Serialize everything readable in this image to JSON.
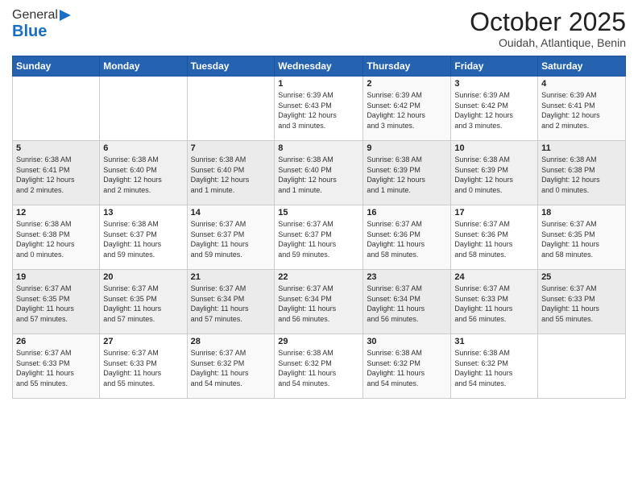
{
  "logo": {
    "general": "General",
    "blue": "Blue"
  },
  "header": {
    "month": "October 2025",
    "location": "Ouidah, Atlantique, Benin"
  },
  "days_of_week": [
    "Sunday",
    "Monday",
    "Tuesday",
    "Wednesday",
    "Thursday",
    "Friday",
    "Saturday"
  ],
  "weeks": [
    [
      {
        "day": "",
        "info": ""
      },
      {
        "day": "",
        "info": ""
      },
      {
        "day": "",
        "info": ""
      },
      {
        "day": "1",
        "info": "Sunrise: 6:39 AM\nSunset: 6:43 PM\nDaylight: 12 hours\nand 3 minutes."
      },
      {
        "day": "2",
        "info": "Sunrise: 6:39 AM\nSunset: 6:42 PM\nDaylight: 12 hours\nand 3 minutes."
      },
      {
        "day": "3",
        "info": "Sunrise: 6:39 AM\nSunset: 6:42 PM\nDaylight: 12 hours\nand 3 minutes."
      },
      {
        "day": "4",
        "info": "Sunrise: 6:39 AM\nSunset: 6:41 PM\nDaylight: 12 hours\nand 2 minutes."
      }
    ],
    [
      {
        "day": "5",
        "info": "Sunrise: 6:38 AM\nSunset: 6:41 PM\nDaylight: 12 hours\nand 2 minutes."
      },
      {
        "day": "6",
        "info": "Sunrise: 6:38 AM\nSunset: 6:40 PM\nDaylight: 12 hours\nand 2 minutes."
      },
      {
        "day": "7",
        "info": "Sunrise: 6:38 AM\nSunset: 6:40 PM\nDaylight: 12 hours\nand 1 minute."
      },
      {
        "day": "8",
        "info": "Sunrise: 6:38 AM\nSunset: 6:40 PM\nDaylight: 12 hours\nand 1 minute."
      },
      {
        "day": "9",
        "info": "Sunrise: 6:38 AM\nSunset: 6:39 PM\nDaylight: 12 hours\nand 1 minute."
      },
      {
        "day": "10",
        "info": "Sunrise: 6:38 AM\nSunset: 6:39 PM\nDaylight: 12 hours\nand 0 minutes."
      },
      {
        "day": "11",
        "info": "Sunrise: 6:38 AM\nSunset: 6:38 PM\nDaylight: 12 hours\nand 0 minutes."
      }
    ],
    [
      {
        "day": "12",
        "info": "Sunrise: 6:38 AM\nSunset: 6:38 PM\nDaylight: 12 hours\nand 0 minutes."
      },
      {
        "day": "13",
        "info": "Sunrise: 6:38 AM\nSunset: 6:37 PM\nDaylight: 11 hours\nand 59 minutes."
      },
      {
        "day": "14",
        "info": "Sunrise: 6:37 AM\nSunset: 6:37 PM\nDaylight: 11 hours\nand 59 minutes."
      },
      {
        "day": "15",
        "info": "Sunrise: 6:37 AM\nSunset: 6:37 PM\nDaylight: 11 hours\nand 59 minutes."
      },
      {
        "day": "16",
        "info": "Sunrise: 6:37 AM\nSunset: 6:36 PM\nDaylight: 11 hours\nand 58 minutes."
      },
      {
        "day": "17",
        "info": "Sunrise: 6:37 AM\nSunset: 6:36 PM\nDaylight: 11 hours\nand 58 minutes."
      },
      {
        "day": "18",
        "info": "Sunrise: 6:37 AM\nSunset: 6:35 PM\nDaylight: 11 hours\nand 58 minutes."
      }
    ],
    [
      {
        "day": "19",
        "info": "Sunrise: 6:37 AM\nSunset: 6:35 PM\nDaylight: 11 hours\nand 57 minutes."
      },
      {
        "day": "20",
        "info": "Sunrise: 6:37 AM\nSunset: 6:35 PM\nDaylight: 11 hours\nand 57 minutes."
      },
      {
        "day": "21",
        "info": "Sunrise: 6:37 AM\nSunset: 6:34 PM\nDaylight: 11 hours\nand 57 minutes."
      },
      {
        "day": "22",
        "info": "Sunrise: 6:37 AM\nSunset: 6:34 PM\nDaylight: 11 hours\nand 56 minutes."
      },
      {
        "day": "23",
        "info": "Sunrise: 6:37 AM\nSunset: 6:34 PM\nDaylight: 11 hours\nand 56 minutes."
      },
      {
        "day": "24",
        "info": "Sunrise: 6:37 AM\nSunset: 6:33 PM\nDaylight: 11 hours\nand 56 minutes."
      },
      {
        "day": "25",
        "info": "Sunrise: 6:37 AM\nSunset: 6:33 PM\nDaylight: 11 hours\nand 55 minutes."
      }
    ],
    [
      {
        "day": "26",
        "info": "Sunrise: 6:37 AM\nSunset: 6:33 PM\nDaylight: 11 hours\nand 55 minutes."
      },
      {
        "day": "27",
        "info": "Sunrise: 6:37 AM\nSunset: 6:33 PM\nDaylight: 11 hours\nand 55 minutes."
      },
      {
        "day": "28",
        "info": "Sunrise: 6:37 AM\nSunset: 6:32 PM\nDaylight: 11 hours\nand 54 minutes."
      },
      {
        "day": "29",
        "info": "Sunrise: 6:38 AM\nSunset: 6:32 PM\nDaylight: 11 hours\nand 54 minutes."
      },
      {
        "day": "30",
        "info": "Sunrise: 6:38 AM\nSunset: 6:32 PM\nDaylight: 11 hours\nand 54 minutes."
      },
      {
        "day": "31",
        "info": "Sunrise: 6:38 AM\nSunset: 6:32 PM\nDaylight: 11 hours\nand 54 minutes."
      },
      {
        "day": "",
        "info": ""
      }
    ]
  ]
}
